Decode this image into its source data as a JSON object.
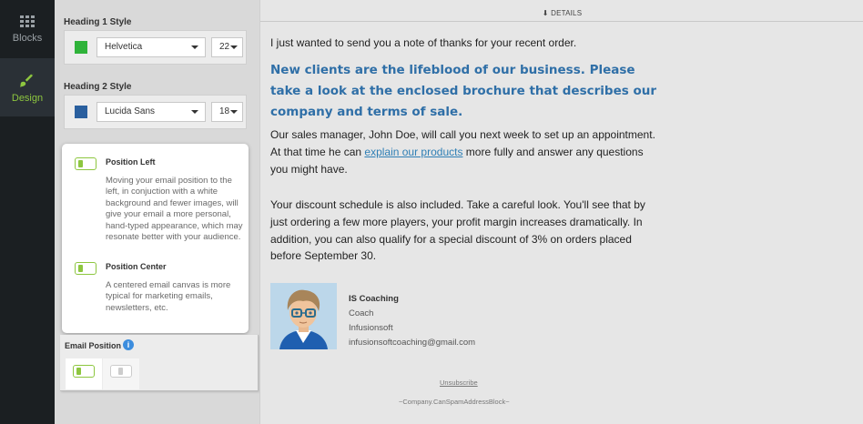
{
  "nav": {
    "items": [
      {
        "label": "Blocks",
        "icon": "grid-icon"
      },
      {
        "label": "Design",
        "icon": "paintbrush-icon"
      }
    ]
  },
  "design_panel": {
    "heading1": {
      "title": "Heading 1 Style",
      "color": "#2fb33a",
      "font": "Helvetica",
      "size": "22"
    },
    "heading2": {
      "title": "Heading 2 Style",
      "color": "#2a5f9e",
      "font": "Lucida Sans",
      "size": "18"
    },
    "positions": [
      {
        "title": "Position Left",
        "description": "Moving your email position to the left, in conjuction with a white background and fewer images, will give your email a more personal, hand-typed appearance, which may resonate better with your audience."
      },
      {
        "title": "Position Center",
        "description": "A centered email canvas is more typical for marketing emails, newsletters, etc."
      }
    ],
    "email_position_label": "Email Position"
  },
  "email": {
    "details_label": "DETAILS",
    "intro": "I just wanted to send you a note of thanks for your recent order.",
    "headline": "New clients are the lifeblood of our business. Please take a look at the enclosed brochure that describes our company and terms of sale.",
    "para2_before": "Our sales manager, John Doe, will call you next week to set up an appointment. At that time he can ",
    "para2_link": "explain our products",
    "para2_after": " more fully and answer any questions you might have.",
    "para3": " Your discount schedule is also included. Take a careful look. You'll see that by just ordering a few more players, your profit margin increases dramatically. In addition, you can also qualify for a special discount of 3% on orders placed before September 30.",
    "signature": {
      "name": "IS Coaching",
      "title": "Coach",
      "company": "Infusionsoft",
      "email": "infusionsoftcoaching@gmail.com"
    },
    "unsubscribe": "Unsubscribe",
    "address_block": "~Company.CanSpamAddressBlock~"
  },
  "colors": {
    "accent_green": "#8dc63f",
    "link_blue": "#2f7fb5",
    "headline_blue": "#2f6fa7"
  }
}
